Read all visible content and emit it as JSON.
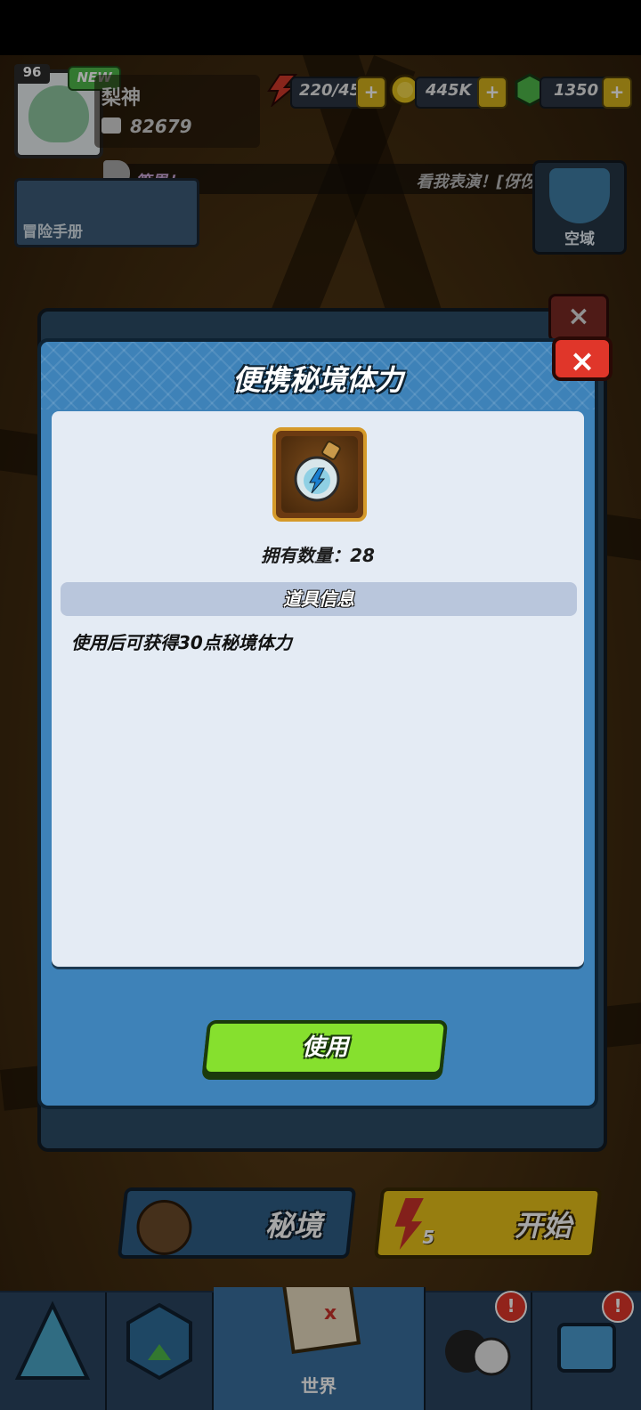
{
  "hud": {
    "level": "96",
    "new_tag": "NEW",
    "player_name": "梨神",
    "power": "82679",
    "stamina": "220/45",
    "gold": "445K",
    "gems": "1350",
    "plus": "+"
  },
  "ticker": {
    "left": "策恩！",
    "right": "看我表演！[伢伢]"
  },
  "side": {
    "manual_label": "冒险手册",
    "zone_label": "空域"
  },
  "modal": {
    "title": "便携秘境体力",
    "close": "×",
    "owned_count": "拥有数量：28",
    "info_header": "道具信息",
    "description": "使用后可获得30点秘境体力",
    "use_button": "使用"
  },
  "bottom": {
    "secret_label": "秘境",
    "start_label": "开始",
    "start_cost": "5"
  },
  "nav": {
    "world_label": "世界",
    "badge": "!"
  },
  "colors": {
    "modal_blue": "#3e82b8",
    "use_green": "#86e02e",
    "close_red": "#e0362a",
    "start_yellow": "#e9c21a"
  }
}
